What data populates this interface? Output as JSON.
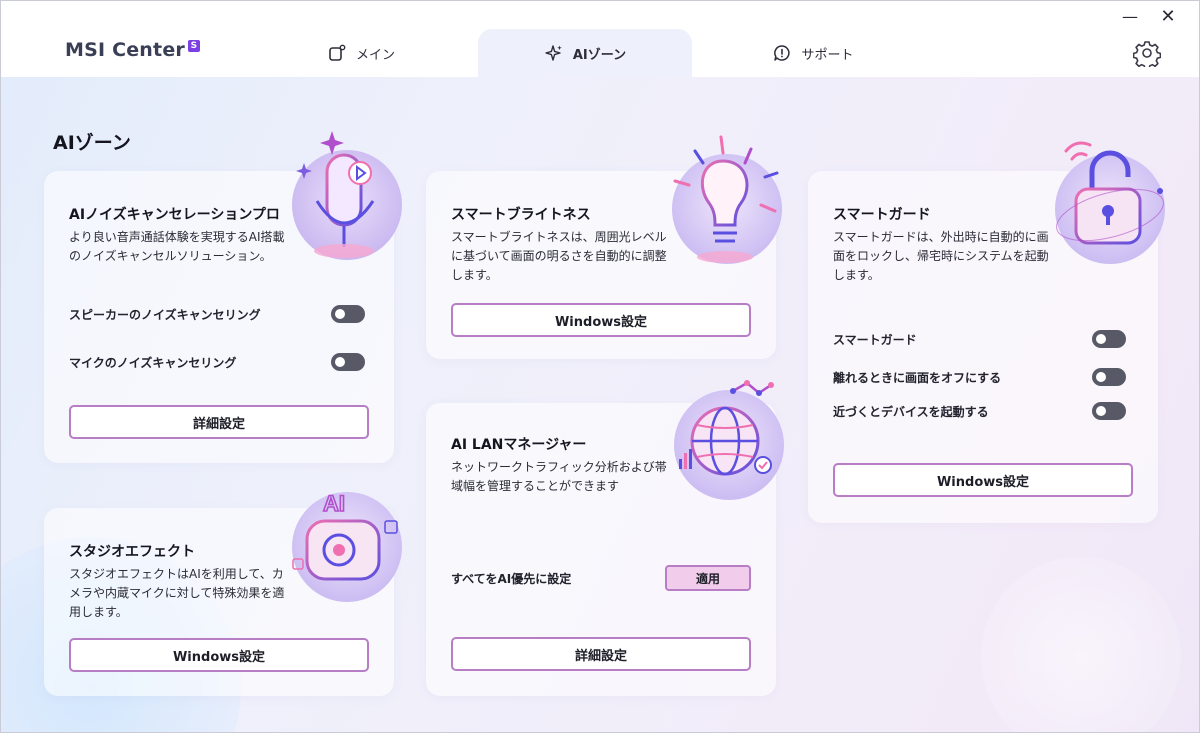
{
  "app": {
    "brand": "MSI Center",
    "brand_badge": "S"
  },
  "window_controls": {
    "minimize": "—",
    "close": "✕"
  },
  "tabs": [
    {
      "label": "メイン",
      "icon": "main-app-icon"
    },
    {
      "label": "AIゾーン",
      "icon": "ai-sparkle-icon",
      "active": true
    },
    {
      "label": "サポート",
      "icon": "support-chat-icon"
    }
  ],
  "page": {
    "title": "AIゾーン"
  },
  "cards": {
    "noise": {
      "title": "AIノイズキャンセレーションプロ",
      "desc": "より良い音声通話体験を実現するAI搭載のノイズキャンセルソリューション。",
      "toggles": [
        {
          "label": "スピーカーのノイズキャンセリング",
          "on": false
        },
        {
          "label": "マイクのノイズキャンセリング",
          "on": false
        }
      ],
      "button": "詳細設定"
    },
    "brightness": {
      "title": "スマートブライトネス",
      "desc": "スマートブライトネスは、周囲光レベルに基づいて画面の明るさを自動的に調整します。",
      "button": "Windows設定"
    },
    "guard": {
      "title": "スマートガード",
      "desc": "スマートガードは、外出時に自動的に画面をロックし、帰宅時にシステムを起動します。",
      "toggles": [
        {
          "label": "スマートガード",
          "on": false
        },
        {
          "label": "離れるときに画面をオフにする",
          "on": false
        },
        {
          "label": "近づくとデバイスを起動する",
          "on": false
        }
      ],
      "button": "Windows設定"
    },
    "studio": {
      "title": "スタジオエフェクト",
      "desc": "スタジオエフェクトはAIを利用して、カメラや内蔵マイクに対して特殊効果を適用します。",
      "button": "Windows設定"
    },
    "lan": {
      "title": "AI LANマネージャー",
      "desc": "ネットワークトラフィック分析および帯域幅を管理することができます",
      "priority_label": "すべてをAI優先に設定",
      "apply_button": "適用",
      "button": "詳細設定"
    }
  },
  "illustration_text": {
    "camera_ai": "AI"
  },
  "colors": {
    "accent": "#b77ec6",
    "toggle_off": "#575a66",
    "brand_badge": "#7b3fe4"
  }
}
